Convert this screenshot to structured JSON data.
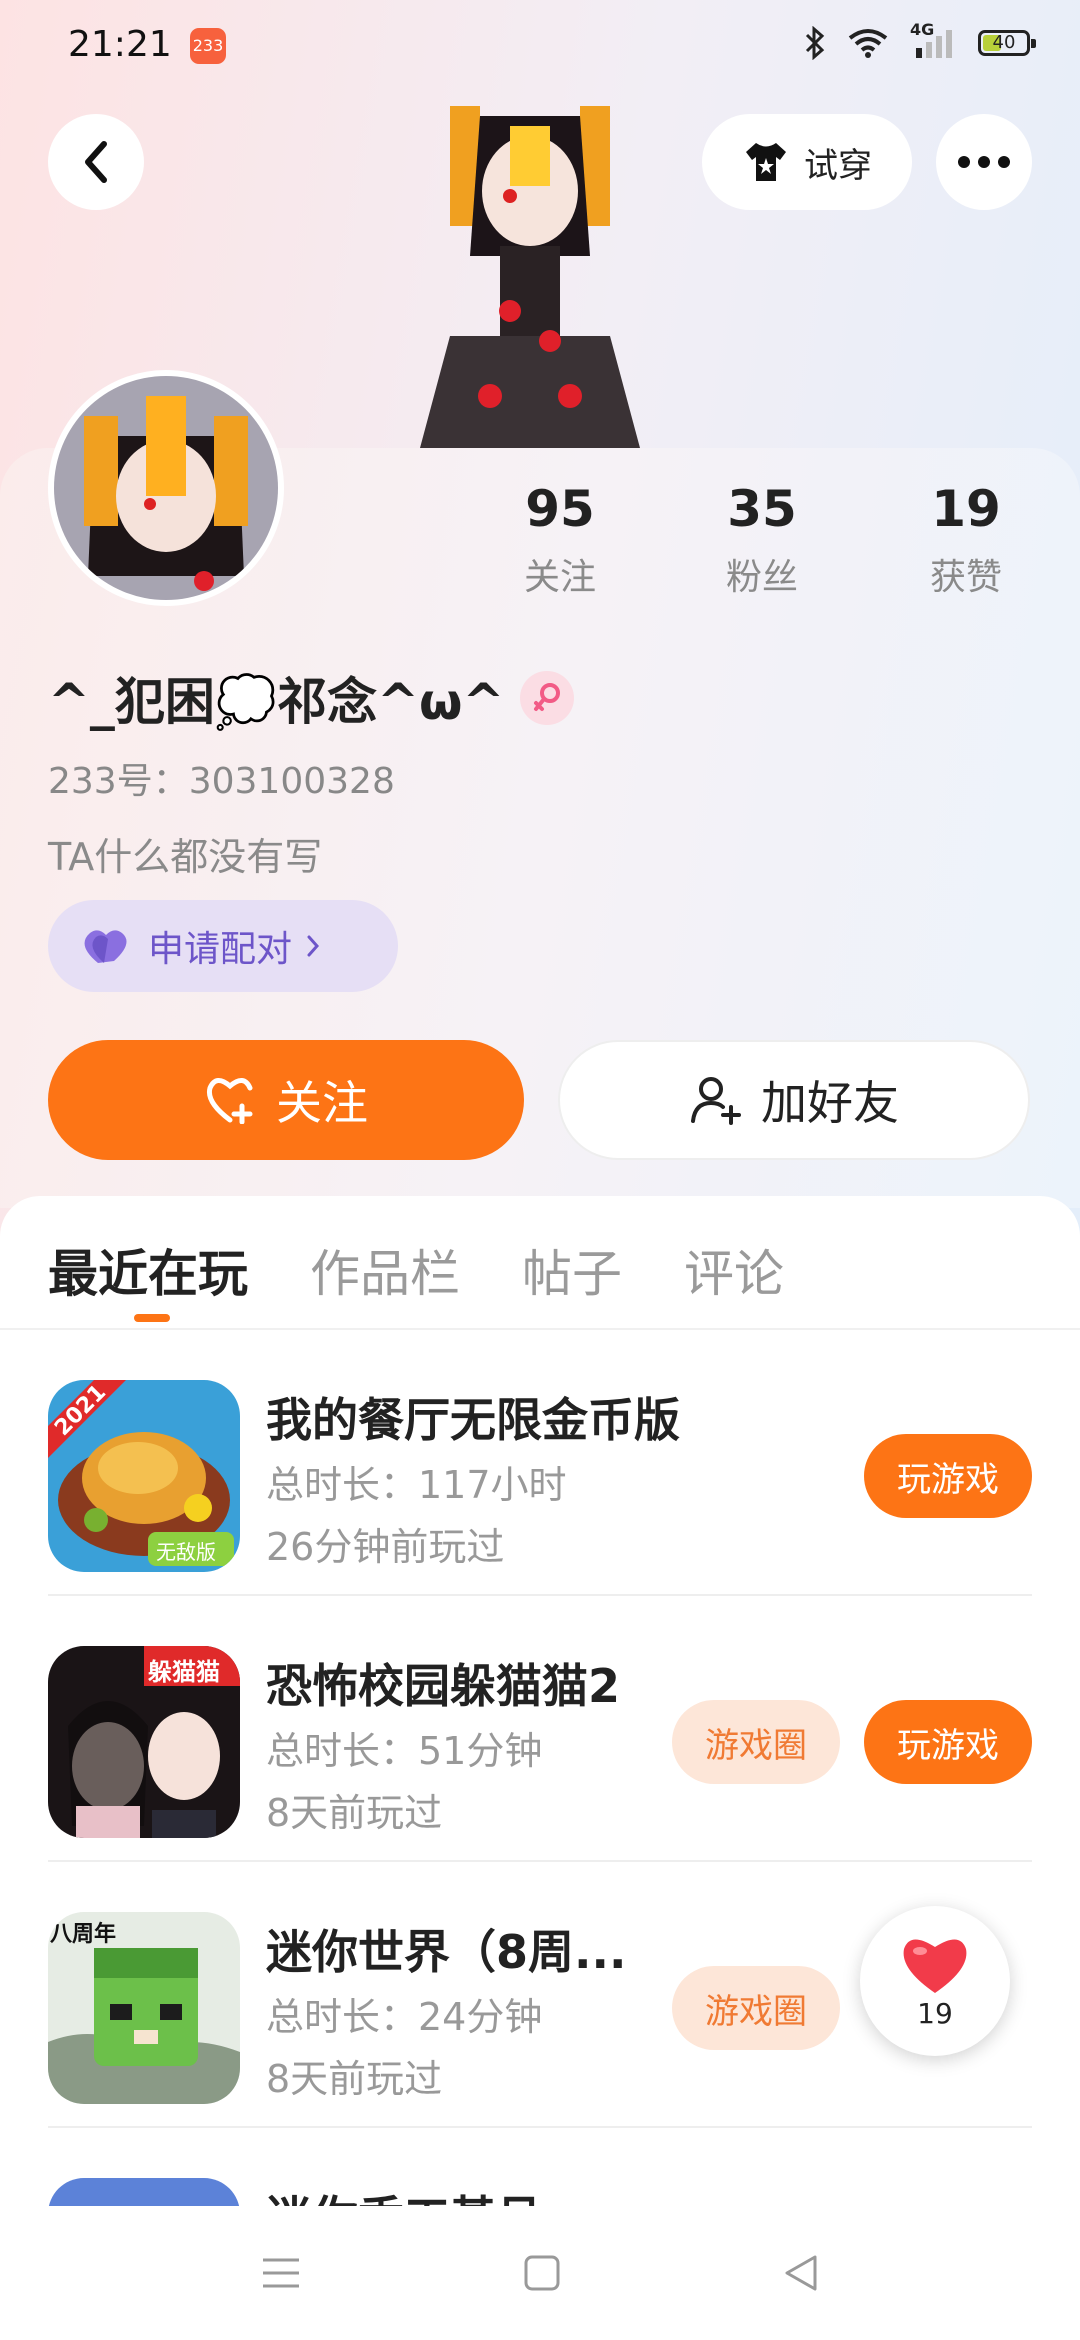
{
  "status_bar": {
    "time": "21:21",
    "network": "4G",
    "battery": "40",
    "app_badge": "233"
  },
  "header": {
    "try_on_label": "试穿"
  },
  "profile": {
    "stats": [
      {
        "value": "95",
        "label": "关注"
      },
      {
        "value": "35",
        "label": "粉丝"
      },
      {
        "value": "19",
        "label": "获赞"
      }
    ],
    "nickname": "^_犯困💭祁念^ω^",
    "uid": "233号：303100328",
    "bio": "TA什么都没有写",
    "pair_label": "申请配对",
    "follow_label": "关注",
    "add_friend_label": "加好友"
  },
  "tabs": [
    {
      "label": "最近在玩",
      "active": true
    },
    {
      "label": "作品栏",
      "active": false
    },
    {
      "label": "帖子",
      "active": false
    },
    {
      "label": "评论",
      "active": false
    }
  ],
  "games": [
    {
      "title": "我的餐厅无限金币版",
      "total_time": "总时长：117小时",
      "last_played": "26分钟前玩过",
      "play_label": "玩游戏",
      "circle_label": "",
      "icon": "roast-chicken-game-icon",
      "icon_badge_year": "2021",
      "icon_badge_tag": "无敌版"
    },
    {
      "title": "恐怖校园躲猫猫2",
      "total_time": "总时长：51分钟",
      "last_played": "8天前玩过",
      "play_label": "玩游戏",
      "circle_label": "游戏圈",
      "icon": "anime-girls-game-icon",
      "icon_badge_tag": "躲猫猫"
    },
    {
      "title": "迷你世界（8周...",
      "total_time": "总时长：24分钟",
      "last_played": "8天前玩过",
      "play_label": "",
      "circle_label": "游戏圈",
      "icon": "mini-world-game-icon",
      "icon_badge_tag": "八周年"
    },
    {
      "title": "迷你香工基吕",
      "total_time": "",
      "last_played": "",
      "play_label": "",
      "circle_label": "",
      "icon": "partial-game-icon"
    }
  ],
  "floating_like": {
    "count": "19"
  },
  "colors": {
    "accent": "#fd7415",
    "pair_purple": "#6d55c9",
    "like_red": "#f23b4a"
  }
}
